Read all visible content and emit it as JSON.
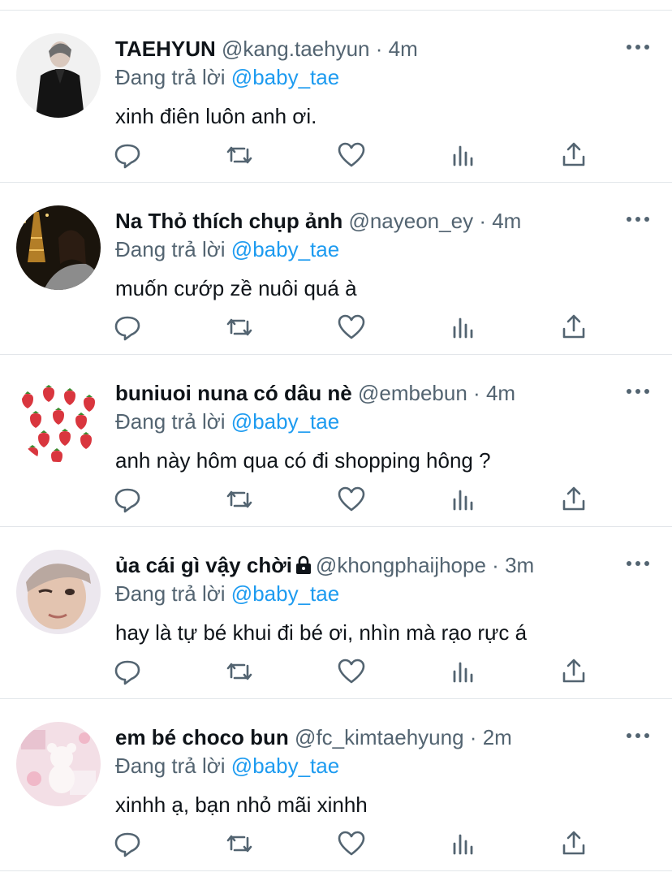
{
  "tweets": [
    {
      "name": "TAEHYUN",
      "handle": "@kang.taehyun",
      "separator": "·",
      "time": "4m",
      "replying_prefix": "Đang trả lời",
      "replying_to": "@baby_tae",
      "text": "xinh điên luôn anh ơi.",
      "locked": false,
      "avatar": "person-in-black-suit"
    },
    {
      "name": "Na Thỏ thích chụp ảnh",
      "handle": "@nayeon_ey",
      "separator": "·",
      "time": "4m",
      "replying_prefix": "Đang trả lời",
      "replying_to": "@baby_tae",
      "text": "muốn cướp zề nuôi quá à",
      "locked": false,
      "avatar": "woman-near-eiffel-tower-at-night"
    },
    {
      "name": "buniuoi nuna có dâu nè",
      "handle": "@embebun",
      "separator": "·",
      "time": "4m",
      "replying_prefix": "Đang trả lời",
      "replying_to": "@baby_tae",
      "text": "anh này hôm qua có đi shopping hông ?",
      "locked": false,
      "avatar": "strawberry-pattern"
    },
    {
      "name": "ủa cái gì vậy chời",
      "handle": "@khongphaijhope",
      "separator": "·",
      "time": "3m",
      "replying_prefix": "Đang trả lời",
      "replying_to": "@baby_tae",
      "text": "hay là tự bé khui đi bé ơi, nhìn mà rạo rực á",
      "locked": true,
      "avatar": "person-winking-closeup"
    },
    {
      "name": "em bé choco bun",
      "handle": "@fc_kimtaehyung",
      "separator": "·",
      "time": "2m",
      "replying_prefix": "Đang trả lời",
      "replying_to": "@baby_tae",
      "text": "xinhh ạ, bạn nhỏ mãi xinhh",
      "locked": false,
      "avatar": "pink-teddy-bear-collage"
    }
  ],
  "action_icons": [
    "reply-icon",
    "retweet-icon",
    "like-icon",
    "views-icon",
    "share-icon"
  ],
  "colors": {
    "text": "#0f1419",
    "secondary": "#536471",
    "accent": "#1d9bf0",
    "divider": "#e2e6ea"
  }
}
